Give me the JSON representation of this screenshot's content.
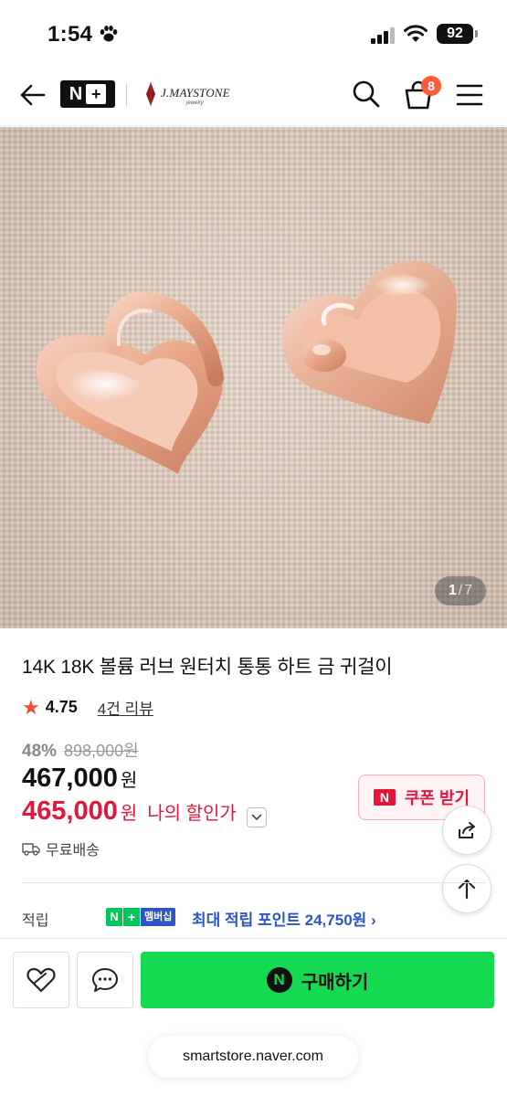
{
  "status_bar": {
    "time": "1:54",
    "battery": "92"
  },
  "nav": {
    "brand_badge": "N",
    "brand_plus": "+",
    "store_name": "J.MAYSTONE",
    "store_sub": "jewelry",
    "cart_count": "8"
  },
  "gallery": {
    "current": "1",
    "separator": "/",
    "total": "7"
  },
  "product": {
    "title": "14K 18K 볼륨 러브 원터치 통통 하트 금 귀걸이",
    "rating": "4.75",
    "reviews": "4건 리뷰",
    "discount_rate": "48%",
    "original_price": "898,000원",
    "price": "467,000",
    "price_unit": "원",
    "my_price": "465,000",
    "my_price_unit": "원",
    "my_price_label": "나의 할인가",
    "coupon_label": "쿠폰 받기",
    "shipping": "무료배송"
  },
  "points": {
    "label": "적립",
    "badge_n": "N",
    "badge_plus": "+",
    "badge_member": "멤버십",
    "text": "최대 적립 포인트 24,750원 ›"
  },
  "bottom": {
    "buy_label": "구매하기",
    "buy_icon": "N"
  },
  "browser": {
    "url": "smartstore.naver.com"
  },
  "colors": {
    "price_red": "#e2173b",
    "naver_green": "#16d952",
    "points_blue": "#2d55c4",
    "cart_badge": "#ff5a3a"
  }
}
